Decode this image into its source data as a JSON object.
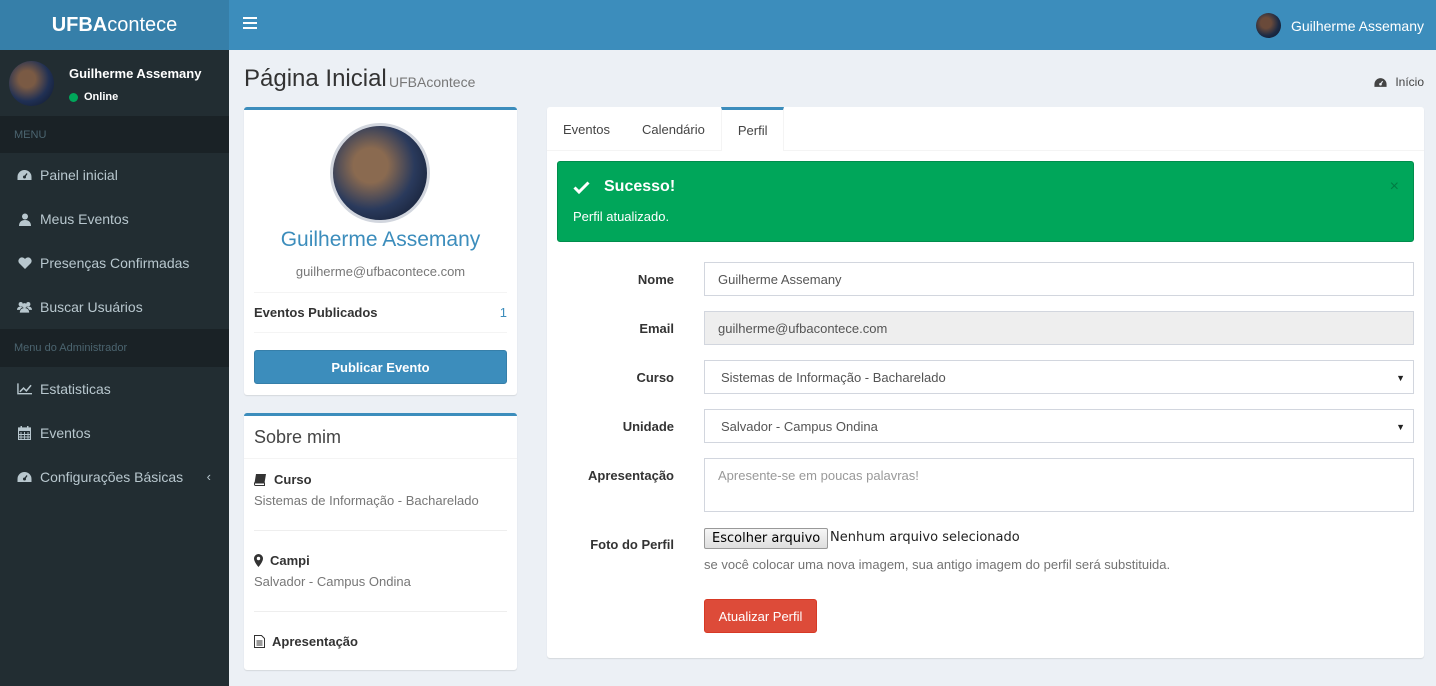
{
  "app": {
    "logo_bold": "UFBA",
    "logo_light": "contece"
  },
  "topbar": {
    "user_name": "Guilherme Assemany"
  },
  "sidebar": {
    "user": {
      "name": "Guilherme Assemany",
      "status": "Online"
    },
    "menu_header": "MENU",
    "items": [
      {
        "label": "Painel inicial",
        "icon": "dashboard-icon"
      },
      {
        "label": "Meus Eventos",
        "icon": "user-icon"
      },
      {
        "label": "Presenças Confirmadas",
        "icon": "heart-icon"
      },
      {
        "label": "Buscar Usuários",
        "icon": "users-icon"
      }
    ],
    "admin_header": "Menu do Administrador",
    "admin_items": [
      {
        "label": "Estatisticas",
        "icon": "line-chart-icon"
      },
      {
        "label": "Eventos",
        "icon": "calendar-icon"
      },
      {
        "label": "Configurações Básicas",
        "icon": "dashboard-icon"
      }
    ]
  },
  "content_header": {
    "title": "Página Inicial",
    "subtitle": "UFBAcontece",
    "breadcrumb": "Início"
  },
  "profile": {
    "name": "Guilherme Assemany",
    "email": "guilherme@ufbacontece.com",
    "stat_label": "Eventos Publicados",
    "stat_value": "1",
    "publish_button": "Publicar Evento"
  },
  "about": {
    "title": "Sobre mim",
    "curso_label": "Curso",
    "curso_value": "Sistemas de Informação - Bacharelado",
    "campi_label": "Campi",
    "campi_value": "Salvador - Campus Ondina",
    "apresentacao_label": "Apresentação"
  },
  "tabs": [
    {
      "label": "Eventos"
    },
    {
      "label": "Calendário"
    },
    {
      "label": "Perfil"
    }
  ],
  "alert": {
    "title": "Sucesso!",
    "message": "Perfil atualizado.",
    "close": "×"
  },
  "form": {
    "nome_label": "Nome",
    "nome_value": "Guilherme Assemany",
    "email_label": "Email",
    "email_value": "guilherme@ufbacontece.com",
    "curso_label": "Curso",
    "curso_value": "Sistemas de Informação - Bacharelado",
    "unidade_label": "Unidade",
    "unidade_value": "Salvador - Campus Ondina",
    "apresentacao_label": "Apresentação",
    "apresentacao_placeholder": "Apresente-se em poucas palavras!",
    "foto_label": "Foto do Perfil",
    "file_button": "Escolher arquivo",
    "file_none": "Nenhum arquivo selecionado",
    "help": "se você colocar uma nova imagem, sua antigo imagem do perfil será substituida.",
    "submit": "Atualizar Perfil"
  },
  "colors": {
    "primary": "#3c8dbc",
    "success": "#00a65a",
    "danger": "#dd4b39",
    "sidebar": "#222d32"
  }
}
